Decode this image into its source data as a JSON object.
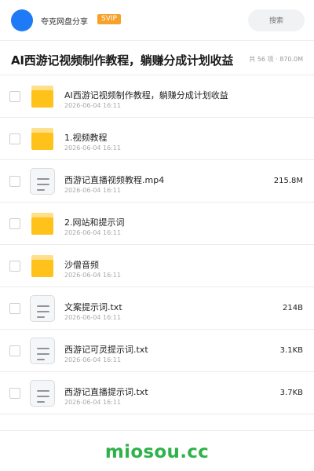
{
  "header": {
    "username": "夸克网盘分享",
    "badge": "SVIP",
    "search_placeholder": "搜索",
    "colors": {
      "avatar": "#1e7bf5",
      "badge": "#f6a12a"
    }
  },
  "share": {
    "title": "AI西游记视频制作教程，躺赚分成计划收益",
    "meta": "共 56 项 · 870.0M"
  },
  "files": [
    {
      "type": "folder",
      "icon": "folder-icon",
      "name": "AI西游记视频制作教程，躺赚分成计划收益",
      "date": "2026-06-04 16:11",
      "size": ""
    },
    {
      "type": "folder",
      "icon": "folder-icon",
      "name": "1.视频教程",
      "date": "2026-06-04 16:11",
      "size": ""
    },
    {
      "type": "file",
      "icon": "file-icon",
      "name": "西游记直播视频教程.mp4",
      "date": "2026-06-04 16:11",
      "size": "215.8M"
    },
    {
      "type": "folder",
      "icon": "folder-icon",
      "name": "2.网站和提示词",
      "date": "2026-06-04 16:11",
      "size": ""
    },
    {
      "type": "folder",
      "icon": "folder-icon",
      "name": "沙僧音频",
      "date": "2026-06-04 16:11",
      "size": ""
    },
    {
      "type": "file",
      "icon": "file-icon",
      "name": "文案提示词.txt",
      "date": "2026-06-04 16:11",
      "size": "214B"
    },
    {
      "type": "file",
      "icon": "file-icon",
      "name": "西游记可灵提示词.txt",
      "date": "2026-06-04 16:11",
      "size": "3.1KB"
    },
    {
      "type": "file",
      "icon": "file-icon",
      "name": "西游记直播提示词.txt",
      "date": "2026-06-04 16:11",
      "size": "3.7KB"
    }
  ],
  "footer": {
    "brand": "miosou.cc",
    "brand_color": "#2fb24a"
  }
}
